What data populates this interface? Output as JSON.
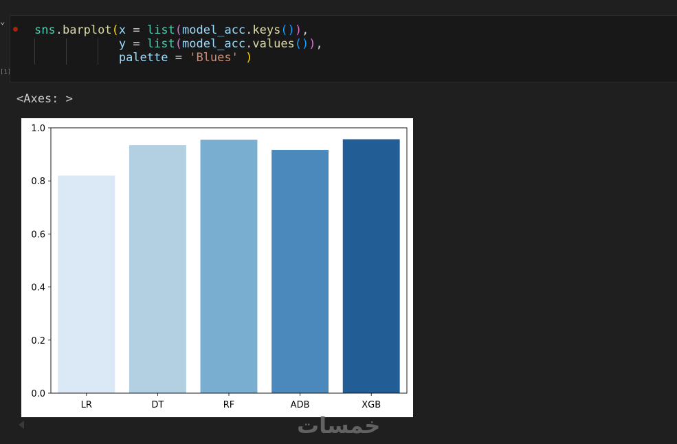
{
  "cell": {
    "execution_count": "[1]",
    "code_lines": [
      [
        {
          "t": "sns",
          "c": "t-id"
        },
        {
          "t": ".",
          "c": "t-op"
        },
        {
          "t": "barplot",
          "c": "t-attr"
        },
        {
          "t": "(",
          "c": "t-p3"
        },
        {
          "t": "x",
          "c": "t-var"
        },
        {
          "t": " = ",
          "c": "t-op"
        },
        {
          "t": "list",
          "c": "t-fn"
        },
        {
          "t": "(",
          "c": "t-p1"
        },
        {
          "t": "model_acc",
          "c": "t-var"
        },
        {
          "t": ".",
          "c": "t-op"
        },
        {
          "t": "keys",
          "c": "t-attr"
        },
        {
          "t": "()",
          "c": "t-p2"
        },
        {
          "t": ")",
          "c": "t-p1"
        },
        {
          "t": ",",
          "c": "t-op"
        }
      ],
      [
        {
          "t": "            ",
          "c": "t-op"
        },
        {
          "t": "y",
          "c": "t-var"
        },
        {
          "t": " = ",
          "c": "t-op"
        },
        {
          "t": "list",
          "c": "t-fn"
        },
        {
          "t": "(",
          "c": "t-p1"
        },
        {
          "t": "model_acc",
          "c": "t-var"
        },
        {
          "t": ".",
          "c": "t-op"
        },
        {
          "t": "values",
          "c": "t-attr"
        },
        {
          "t": "()",
          "c": "t-p2"
        },
        {
          "t": ")",
          "c": "t-p1"
        },
        {
          "t": ",",
          "c": "t-op"
        }
      ],
      [
        {
          "t": "            ",
          "c": "t-op"
        },
        {
          "t": "palette",
          "c": "t-var"
        },
        {
          "t": " = ",
          "c": "t-op"
        },
        {
          "t": "'Blues'",
          "c": "t-str"
        },
        {
          "t": " ",
          "c": "t-op"
        },
        {
          "t": ")",
          "c": "t-p3"
        }
      ]
    ]
  },
  "output": {
    "text": "<Axes: >"
  },
  "chart_data": {
    "type": "bar",
    "categories": [
      "LR",
      "DT",
      "RF",
      "ADB",
      "XGB"
    ],
    "values": [
      0.82,
      0.935,
      0.955,
      0.917,
      0.957
    ],
    "colors": [
      "#dbe9f6",
      "#b3d0e3",
      "#79aed0",
      "#4b89bd",
      "#225d95"
    ],
    "yticks": [
      "0.0",
      "0.2",
      "0.4",
      "0.6",
      "0.8",
      "1.0"
    ],
    "ylim": [
      0,
      1.0
    ],
    "xlabel": "",
    "ylabel": "",
    "grid": false
  },
  "watermark": {
    "text": "خمسات"
  },
  "icons": {
    "collapse": "chevron-down-icon",
    "status": "error-dot-icon",
    "scroll": "scroll-left-icon"
  }
}
